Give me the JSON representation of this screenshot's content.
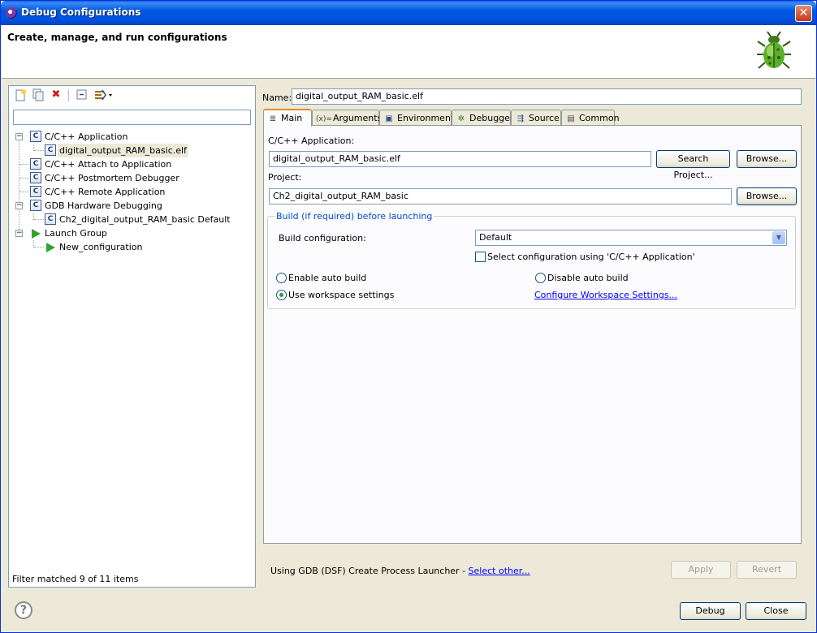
{
  "window": {
    "title": "Debug Configurations",
    "close_glyph": "✕"
  },
  "header": {
    "title": "Create, manage, and run configurations"
  },
  "left": {
    "filter_placeholder": "",
    "filter_status": "Filter matched 9 of 11 items",
    "tree": [
      {
        "label": "C/C++ Application",
        "type": "c",
        "expanded": true
      },
      {
        "label": "digital_output_RAM_basic.elf",
        "type": "c",
        "child": true,
        "selected": true
      },
      {
        "label": "C/C++ Attach to Application",
        "type": "c"
      },
      {
        "label": "C/C++ Postmortem Debugger",
        "type": "c"
      },
      {
        "label": "C/C++ Remote Application",
        "type": "c"
      },
      {
        "label": "GDB Hardware Debugging",
        "type": "c",
        "expanded": true
      },
      {
        "label": "Ch2_digital_output_RAM_basic Default",
        "type": "c",
        "child": true
      },
      {
        "label": "Launch Group",
        "type": "launch",
        "expanded": true
      },
      {
        "label": "New_configuration",
        "type": "launch",
        "child": true
      }
    ]
  },
  "right": {
    "name_label": "Name:",
    "name_value": "digital_output_RAM_basic.elf",
    "tabs": [
      {
        "label": "Main",
        "icon": "≣",
        "active": true
      },
      {
        "label": "Arguments",
        "icon": "(x)="
      },
      {
        "label": "Environment",
        "icon": "▣"
      },
      {
        "label": "Debugger",
        "icon": "✲"
      },
      {
        "label": "Source",
        "icon": "⇶"
      },
      {
        "label": "Common",
        "icon": "▤"
      }
    ],
    "main": {
      "app_label": "C/C++ Application:",
      "app_value": "digital_output_RAM_basic.elf",
      "search_project_btn": "Search Project...",
      "browse_btn": "Browse...",
      "project_label": "Project:",
      "project_value": "Ch2_digital_output_RAM_basic",
      "browse_btn2": "Browse...",
      "build_group_title": "Build (if required) before launching",
      "build_config_label": "Build configuration:",
      "build_config_value": "Default",
      "select_config_label": "Select configuration using 'C/C++ Application'",
      "enable_auto_build": "Enable auto build",
      "disable_auto_build": "Disable auto build",
      "use_workspace": "Use workspace settings",
      "configure_link": "Configure Workspace Settings..."
    },
    "launcher_text": "Using GDB (DSF) Create Process Launcher - ",
    "select_other_link": "Select other...",
    "apply_btn": "Apply",
    "revert_btn": "Revert"
  },
  "footer": {
    "help_glyph": "?",
    "debug_btn": "Debug",
    "close_btn": "Close"
  },
  "colors": {
    "titlebar": "#0054e3",
    "link": "#0000ff",
    "group_title": "#0046d5"
  }
}
